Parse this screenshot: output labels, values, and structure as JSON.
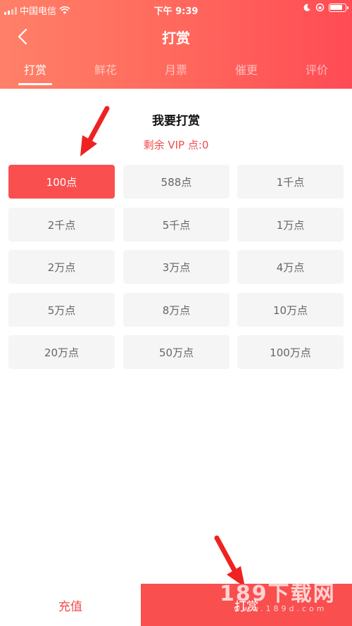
{
  "status_bar": {
    "carrier": "中国电信",
    "time": "下午 9:39",
    "icons": [
      "signal-icon",
      "wifi-icon",
      "moon-icon",
      "lock-rotation-icon",
      "battery-icon"
    ]
  },
  "header": {
    "title": "打赏",
    "back_icon": "chevron-left-icon"
  },
  "tabs": [
    {
      "label": "打赏",
      "active": true
    },
    {
      "label": "鲜花",
      "active": false
    },
    {
      "label": "月票",
      "active": false
    },
    {
      "label": "催更",
      "active": false
    },
    {
      "label": "评价",
      "active": false
    }
  ],
  "panel": {
    "title": "我要打赏",
    "balance": "剩余 VIP 点:0"
  },
  "options": [
    {
      "label": "100点",
      "selected": true
    },
    {
      "label": "588点",
      "selected": false
    },
    {
      "label": "1千点",
      "selected": false
    },
    {
      "label": "2千点",
      "selected": false
    },
    {
      "label": "5千点",
      "selected": false
    },
    {
      "label": "1万点",
      "selected": false
    },
    {
      "label": "2万点",
      "selected": false
    },
    {
      "label": "3万点",
      "selected": false
    },
    {
      "label": "4万点",
      "selected": false
    },
    {
      "label": "5万点",
      "selected": false
    },
    {
      "label": "8万点",
      "selected": false
    },
    {
      "label": "10万点",
      "selected": false
    },
    {
      "label": "20万点",
      "selected": false
    },
    {
      "label": "50万点",
      "selected": false
    },
    {
      "label": "100万点",
      "selected": false
    }
  ],
  "bottom": {
    "recharge_label": "充值",
    "reward_label": "打赏"
  },
  "watermark": {
    "main": "189下载网",
    "sub": "www.189d.com"
  },
  "colors": {
    "accent": "#f94f4f",
    "header_start": "#ff8068",
    "header_end": "#ff4b55",
    "option_bg": "#f5f5f5"
  }
}
